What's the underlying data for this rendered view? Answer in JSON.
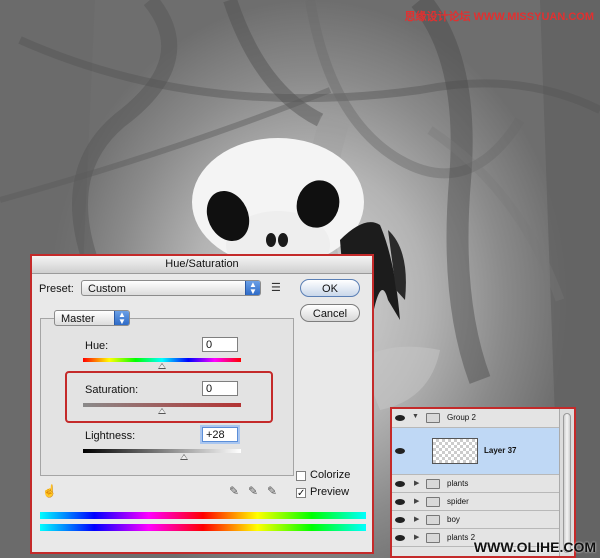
{
  "watermark_top": "思缘设计论坛 WWW.MISSYUAN.COM",
  "watermark_bottom": "WWW.OLIHE.COM",
  "dialog": {
    "title": "Hue/Saturation",
    "preset_label": "Preset:",
    "preset_value": "Custom",
    "channel_value": "Master",
    "ok_label": "OK",
    "cancel_label": "Cancel",
    "hue_label": "Hue:",
    "hue_value": "0",
    "saturation_label": "Saturation:",
    "saturation_value": "0",
    "lightness_label": "Lightness:",
    "lightness_value": "+28",
    "colorize_label": "Colorize",
    "colorize_checked": false,
    "preview_label": "Preview",
    "preview_checked": true,
    "preview_check_mark": "✓"
  },
  "layers": {
    "items": [
      {
        "name": "Group 2",
        "type": "group-open"
      },
      {
        "name": "Layer 37",
        "type": "layer-selected"
      },
      {
        "name": "plants",
        "type": "group"
      },
      {
        "name": "spider",
        "type": "group"
      },
      {
        "name": "boy",
        "type": "group"
      },
      {
        "name": "plants 2",
        "type": "group"
      }
    ]
  },
  "colors": {
    "highlight_red": "#c42a2a",
    "selected_layer": "#bfd8f5",
    "accent_blue": "#2f6bc7"
  }
}
